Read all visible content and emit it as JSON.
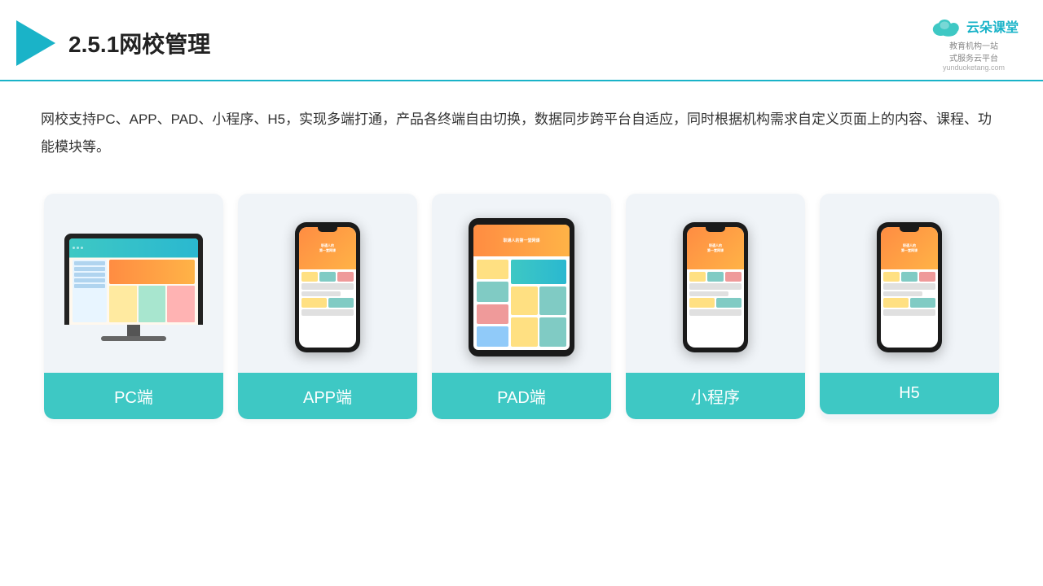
{
  "header": {
    "title": "2.5.1网校管理",
    "brand_name": "云朵课堂",
    "brand_url": "yunduoketang.com",
    "brand_tagline": "教育机构一站\n式服务云平台"
  },
  "description": "网校支持PC、APP、PAD、小程序、H5，实现多端打通，产品各终端自由切换，数据同步跨平台自适应，同时根据机构需求自定义页面上的内容、课程、功能模块等。",
  "cards": [
    {
      "id": "pc",
      "label": "PC端"
    },
    {
      "id": "app",
      "label": "APP端"
    },
    {
      "id": "pad",
      "label": "PAD端"
    },
    {
      "id": "mini",
      "label": "小程序"
    },
    {
      "id": "h5",
      "label": "H5"
    }
  ],
  "colors": {
    "accent": "#3ec8c4",
    "dark": "#1a1a1a",
    "bg_card": "#f0f4f8"
  }
}
